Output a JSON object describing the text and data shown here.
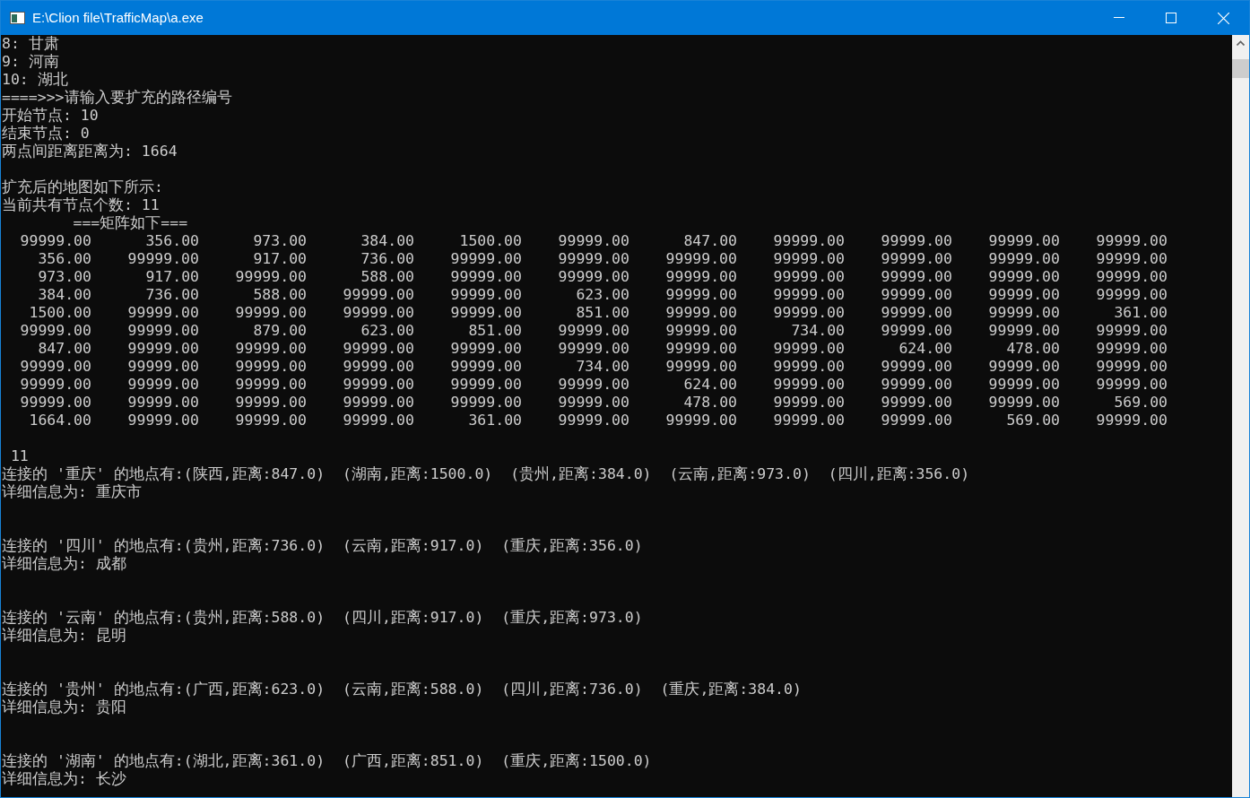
{
  "window": {
    "title": "E:\\Clion file\\TrafficMap\\a.exe"
  },
  "console": [
    {
      "kind": "text",
      "text": "8: 甘肃"
    },
    {
      "kind": "text",
      "text": "9: 河南"
    },
    {
      "kind": "text",
      "text": "10: 湖北"
    },
    {
      "kind": "text",
      "text": "====>>>请输入要扩充的路径编号"
    },
    {
      "kind": "text",
      "text": "开始节点: 10"
    },
    {
      "kind": "text",
      "text": "结束节点: 0"
    },
    {
      "kind": "text",
      "text": "两点间距离距离为: 1664"
    },
    {
      "kind": "blank"
    },
    {
      "kind": "text",
      "text": "扩充后的地图如下所示:"
    },
    {
      "kind": "text",
      "text": "当前共有节点个数: 11"
    },
    {
      "kind": "text",
      "text": "        ===矩阵如下==="
    },
    {
      "kind": "matrix_row",
      "cells": [
        "99999.00",
        "356.00",
        "973.00",
        "384.00",
        "1500.00",
        "99999.00",
        "847.00",
        "99999.00",
        "99999.00",
        "99999.00",
        "99999.00"
      ]
    },
    {
      "kind": "matrix_row",
      "cells": [
        "356.00",
        "99999.00",
        "917.00",
        "736.00",
        "99999.00",
        "99999.00",
        "99999.00",
        "99999.00",
        "99999.00",
        "99999.00",
        "99999.00"
      ]
    },
    {
      "kind": "matrix_row",
      "cells": [
        "973.00",
        "917.00",
        "99999.00",
        "588.00",
        "99999.00",
        "99999.00",
        "99999.00",
        "99999.00",
        "99999.00",
        "99999.00",
        "99999.00"
      ]
    },
    {
      "kind": "matrix_row",
      "cells": [
        "384.00",
        "736.00",
        "588.00",
        "99999.00",
        "99999.00",
        "623.00",
        "99999.00",
        "99999.00",
        "99999.00",
        "99999.00",
        "99999.00"
      ]
    },
    {
      "kind": "matrix_row",
      "cells": [
        "1500.00",
        "99999.00",
        "99999.00",
        "99999.00",
        "99999.00",
        "851.00",
        "99999.00",
        "99999.00",
        "99999.00",
        "99999.00",
        "361.00"
      ]
    },
    {
      "kind": "matrix_row",
      "cells": [
        "99999.00",
        "99999.00",
        "879.00",
        "623.00",
        "851.00",
        "99999.00",
        "99999.00",
        "734.00",
        "99999.00",
        "99999.00",
        "99999.00"
      ]
    },
    {
      "kind": "matrix_row",
      "cells": [
        "847.00",
        "99999.00",
        "99999.00",
        "99999.00",
        "99999.00",
        "99999.00",
        "99999.00",
        "99999.00",
        "624.00",
        "478.00",
        "99999.00"
      ]
    },
    {
      "kind": "matrix_row",
      "cells": [
        "99999.00",
        "99999.00",
        "99999.00",
        "99999.00",
        "99999.00",
        "734.00",
        "99999.00",
        "99999.00",
        "99999.00",
        "99999.00",
        "99999.00"
      ]
    },
    {
      "kind": "matrix_row",
      "cells": [
        "99999.00",
        "99999.00",
        "99999.00",
        "99999.00",
        "99999.00",
        "99999.00",
        "624.00",
        "99999.00",
        "99999.00",
        "99999.00",
        "99999.00"
      ]
    },
    {
      "kind": "matrix_row",
      "cells": [
        "99999.00",
        "99999.00",
        "99999.00",
        "99999.00",
        "99999.00",
        "99999.00",
        "478.00",
        "99999.00",
        "99999.00",
        "99999.00",
        "569.00"
      ]
    },
    {
      "kind": "matrix_row",
      "cells": [
        "1664.00",
        "99999.00",
        "99999.00",
        "99999.00",
        "361.00",
        "99999.00",
        "99999.00",
        "99999.00",
        "99999.00",
        "569.00",
        "99999.00"
      ]
    },
    {
      "kind": "blank"
    },
    {
      "kind": "text",
      "text": " 11"
    },
    {
      "kind": "text",
      "text": "连接的 '重庆' 的地点有:(陕西,距离:847.0)  (湖南,距离:1500.0)  (贵州,距离:384.0)  (云南,距离:973.0)  (四川,距离:356.0)"
    },
    {
      "kind": "text",
      "text": "详细信息为: 重庆市"
    },
    {
      "kind": "blank"
    },
    {
      "kind": "blank"
    },
    {
      "kind": "text",
      "text": "连接的 '四川' 的地点有:(贵州,距离:736.0)  (云南,距离:917.0)  (重庆,距离:356.0)"
    },
    {
      "kind": "text",
      "text": "详细信息为: 成都"
    },
    {
      "kind": "blank"
    },
    {
      "kind": "blank"
    },
    {
      "kind": "text",
      "text": "连接的 '云南' 的地点有:(贵州,距离:588.0)  (四川,距离:917.0)  (重庆,距离:973.0)"
    },
    {
      "kind": "text",
      "text": "详细信息为: 昆明"
    },
    {
      "kind": "blank"
    },
    {
      "kind": "blank"
    },
    {
      "kind": "text",
      "text": "连接的 '贵州' 的地点有:(广西,距离:623.0)  (云南,距离:588.0)  (四川,距离:736.0)  (重庆,距离:384.0)"
    },
    {
      "kind": "text",
      "text": "详细信息为: 贵阳"
    },
    {
      "kind": "blank"
    },
    {
      "kind": "blank"
    },
    {
      "kind": "text",
      "text": "连接的 '湖南' 的地点有:(湖北,距离:361.0)  (广西,距离:851.0)  (重庆,距离:1500.0)"
    },
    {
      "kind": "text",
      "text": "详细信息为: 长沙"
    }
  ]
}
